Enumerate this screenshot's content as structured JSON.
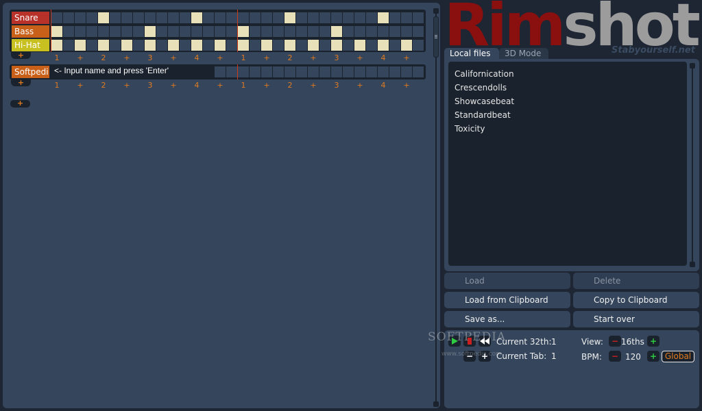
{
  "app": {
    "logo_part1": "Rim",
    "logo_part2": "shot",
    "logo_sub": "Stabyourself.net",
    "colors": {
      "background": "#1e2633",
      "panel": "#34455c",
      "dark": "#1a222d",
      "accent_orange": "#e07b20",
      "logo_red": "#8a0f0f",
      "note_on": "#e8e0b8",
      "playhead": "#cc3a1a"
    }
  },
  "sequencer": {
    "tab1": {
      "instruments": [
        {
          "name": "Snare",
          "color": "#b8322a",
          "steps": [
            4,
            12,
            20,
            28
          ]
        },
        {
          "name": "Bass",
          "color": "#c8601a",
          "steps": [
            0,
            8,
            16,
            24
          ]
        },
        {
          "name": "Hi-Hat",
          "color": "#c8c020",
          "steps": [
            0,
            2,
            4,
            6,
            8,
            10,
            12,
            14,
            16,
            18,
            20,
            22,
            24,
            26,
            28,
            30
          ]
        }
      ],
      "add_label": "+"
    },
    "tab2": {
      "instrument_name": "Softpedi",
      "instrument_color": "#c8601a",
      "input_text": "<- Input name and press 'Enter'",
      "add_label": "+"
    },
    "beat_labels": [
      "1",
      "+",
      "2",
      "+",
      "3",
      "+",
      "4",
      "+",
      "1",
      "+",
      "2",
      "+",
      "3",
      "+",
      "4",
      "+"
    ],
    "add_tab_label": "+",
    "playhead_step": 16
  },
  "file_browser": {
    "tabs": [
      {
        "label": "Local files",
        "active": true
      },
      {
        "label": "3D Mode",
        "active": false
      }
    ],
    "files": [
      "Californication",
      "Crescendolls",
      "Showcasebeat",
      "Standardbeat",
      "Toxicity"
    ]
  },
  "buttons": {
    "load": "Load",
    "delete": "Delete",
    "load_clipboard": "Load from Clipboard",
    "copy_clipboard": "Copy to Clipboard",
    "save_as": "Save as...",
    "start_over": "Start over"
  },
  "controls": {
    "play_icon": "play-icon",
    "rec_icon": "record-icon",
    "rewind_icon": "rewind-icon",
    "current32_label": "Current 32th:",
    "current32_value": "1",
    "current_tab_label": "Current Tab:",
    "current_tab_value": "1",
    "view_label": "View:",
    "view_value": "16ths",
    "bpm_label": "BPM:",
    "bpm_value": "120",
    "global_label": "Global",
    "minus_label": "−",
    "plus_label": "+"
  },
  "watermark": {
    "text": "SOFTPEDIA",
    "sub": "www.softpedia.com"
  }
}
